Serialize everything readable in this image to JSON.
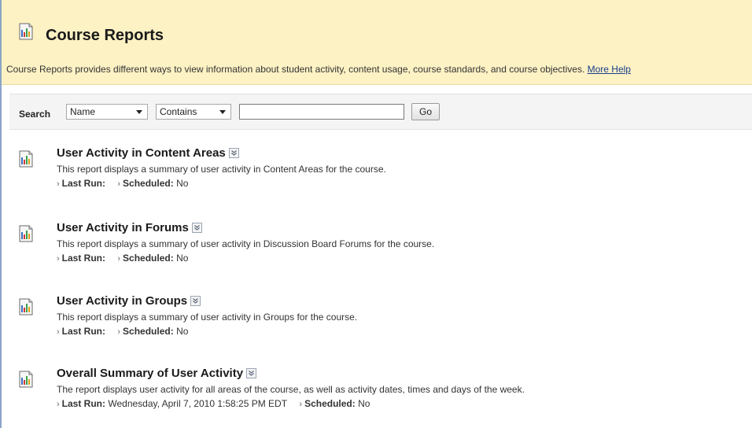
{
  "header": {
    "title": "Course Reports",
    "description": "Course Reports provides different ways to view information about student activity, content usage, course standards, and course objectives.",
    "help_link": "More Help"
  },
  "search": {
    "label": "Search",
    "field_value": "Name",
    "operator_value": "Contains",
    "input_value": "",
    "go_label": "Go"
  },
  "meta_labels": {
    "last_run": "Last Run:",
    "scheduled": "Scheduled:"
  },
  "reports": [
    {
      "title": "User Activity in Content Areas",
      "description": "This report displays a summary of user activity in Content Areas for the course.",
      "last_run": "",
      "scheduled": "No"
    },
    {
      "title": "User Activity in Forums",
      "description": "This report displays a summary of user activity in Discussion Board Forums for the course.",
      "last_run": "",
      "scheduled": "No"
    },
    {
      "title": "User Activity in Groups",
      "description": "This report displays a summary of user activity in Groups for the course.",
      "last_run": "",
      "scheduled": "No"
    },
    {
      "title": "Overall Summary of User Activity",
      "description": "The report displays user activity for all areas of the course, as well as activity dates, times and days of the week.",
      "last_run": "Wednesday, April 7, 2010 1:58:25 PM EDT",
      "scheduled": "No"
    }
  ],
  "icons": {
    "report": "report-chart-icon",
    "menu": "chevron-double-down-icon"
  },
  "colors": {
    "header_bg": "#fdf2c4",
    "link": "#1a3e8c",
    "search_bg": "#f4f4f4"
  }
}
